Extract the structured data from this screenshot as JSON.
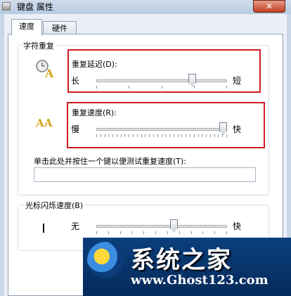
{
  "window": {
    "title": "键盘 属性",
    "close_glyph": "✕"
  },
  "tabs": [
    {
      "label": "速度",
      "active": true
    },
    {
      "label": "硬件",
      "active": false
    }
  ],
  "character_repeat": {
    "legend": "字符重复",
    "delay": {
      "label": "重复延迟(D):",
      "min_label": "长",
      "max_label": "短",
      "value": 0.75,
      "ticks": 4
    },
    "rate": {
      "label": "重复速度(R):",
      "min_label": "慢",
      "max_label": "快",
      "value": 1.0,
      "ticks": 32
    },
    "test_prompt": "单击此处并按住一个键以便测试重复速度(T):",
    "test_value": ""
  },
  "cursor_blink": {
    "legend": "光标闪烁速度(B)",
    "min_label": "无",
    "max_label": "快",
    "value": 0.6,
    "ticks": 11
  },
  "watermark": {
    "title": "系统之家",
    "url": "www.Ghost123.com"
  },
  "colors": {
    "highlight": "#d11b23"
  }
}
